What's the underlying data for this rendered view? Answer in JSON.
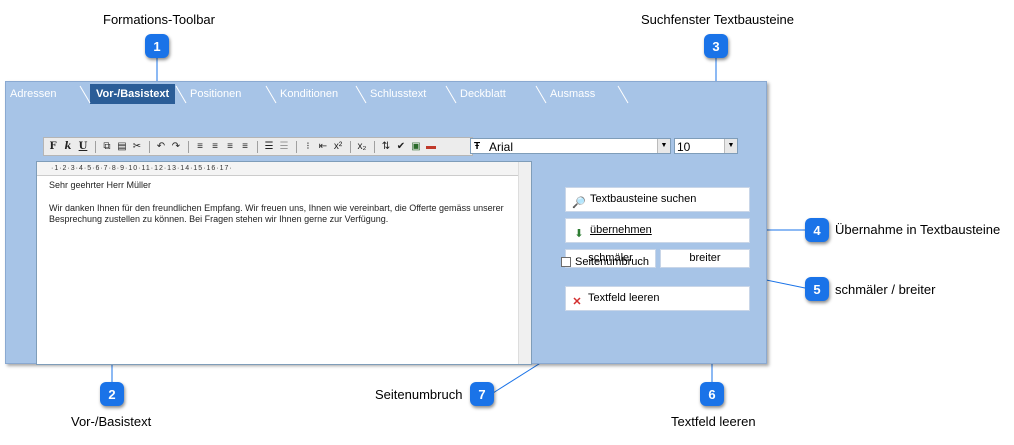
{
  "callouts": {
    "c1": {
      "number": "1",
      "label": "Formations-Toolbar"
    },
    "c2": {
      "number": "2",
      "label": "Vor-/Basistext"
    },
    "c3": {
      "number": "3",
      "label": "Suchfenster Textbausteine"
    },
    "c4": {
      "number": "4",
      "label": "Übernahme in Textbausteine"
    },
    "c5": {
      "number": "5",
      "label": "schmäler / breiter"
    },
    "c6": {
      "number": "6",
      "label": "Textfeld leeren"
    },
    "c7": {
      "number": "7",
      "label": "Seitenumbruch"
    }
  },
  "tabs": [
    "Adressen",
    "Vor-/Basistext",
    "Positionen",
    "Konditionen",
    "Schlusstext",
    "Deckblatt",
    "Ausmass"
  ],
  "toolbar": {
    "format_buttons": [
      "F",
      "k",
      "U"
    ],
    "font_name": "Arial",
    "font_size": "10"
  },
  "ruler": "·1·2·3·4·5·6·7·8·9·10·11·12·13·14·15·16·17·",
  "editor": {
    "line1": "Sehr geehrter Herr Müller",
    "line2": "Wir danken Ihnen für den freundlichen Empfang. Wir freuen uns, Ihnen wie vereinbart, die Offerte gemäss unserer",
    "line3": "Besprechung zustellen zu können. Bei Fragen stehen wir Ihnen gerne zur Verfügung."
  },
  "panel": {
    "search_label": "Textbausteine suchen",
    "take_label": "übernehmen",
    "narrow_label": "schmäler",
    "wide_label": "breiter",
    "clear_label": "Textfeld leeren",
    "pagebreak_label": "Seitenumbruch"
  },
  "colors": {
    "badge": "#1a73e8",
    "window": "#a7c4e7",
    "active_tab": "#2b5d97"
  }
}
